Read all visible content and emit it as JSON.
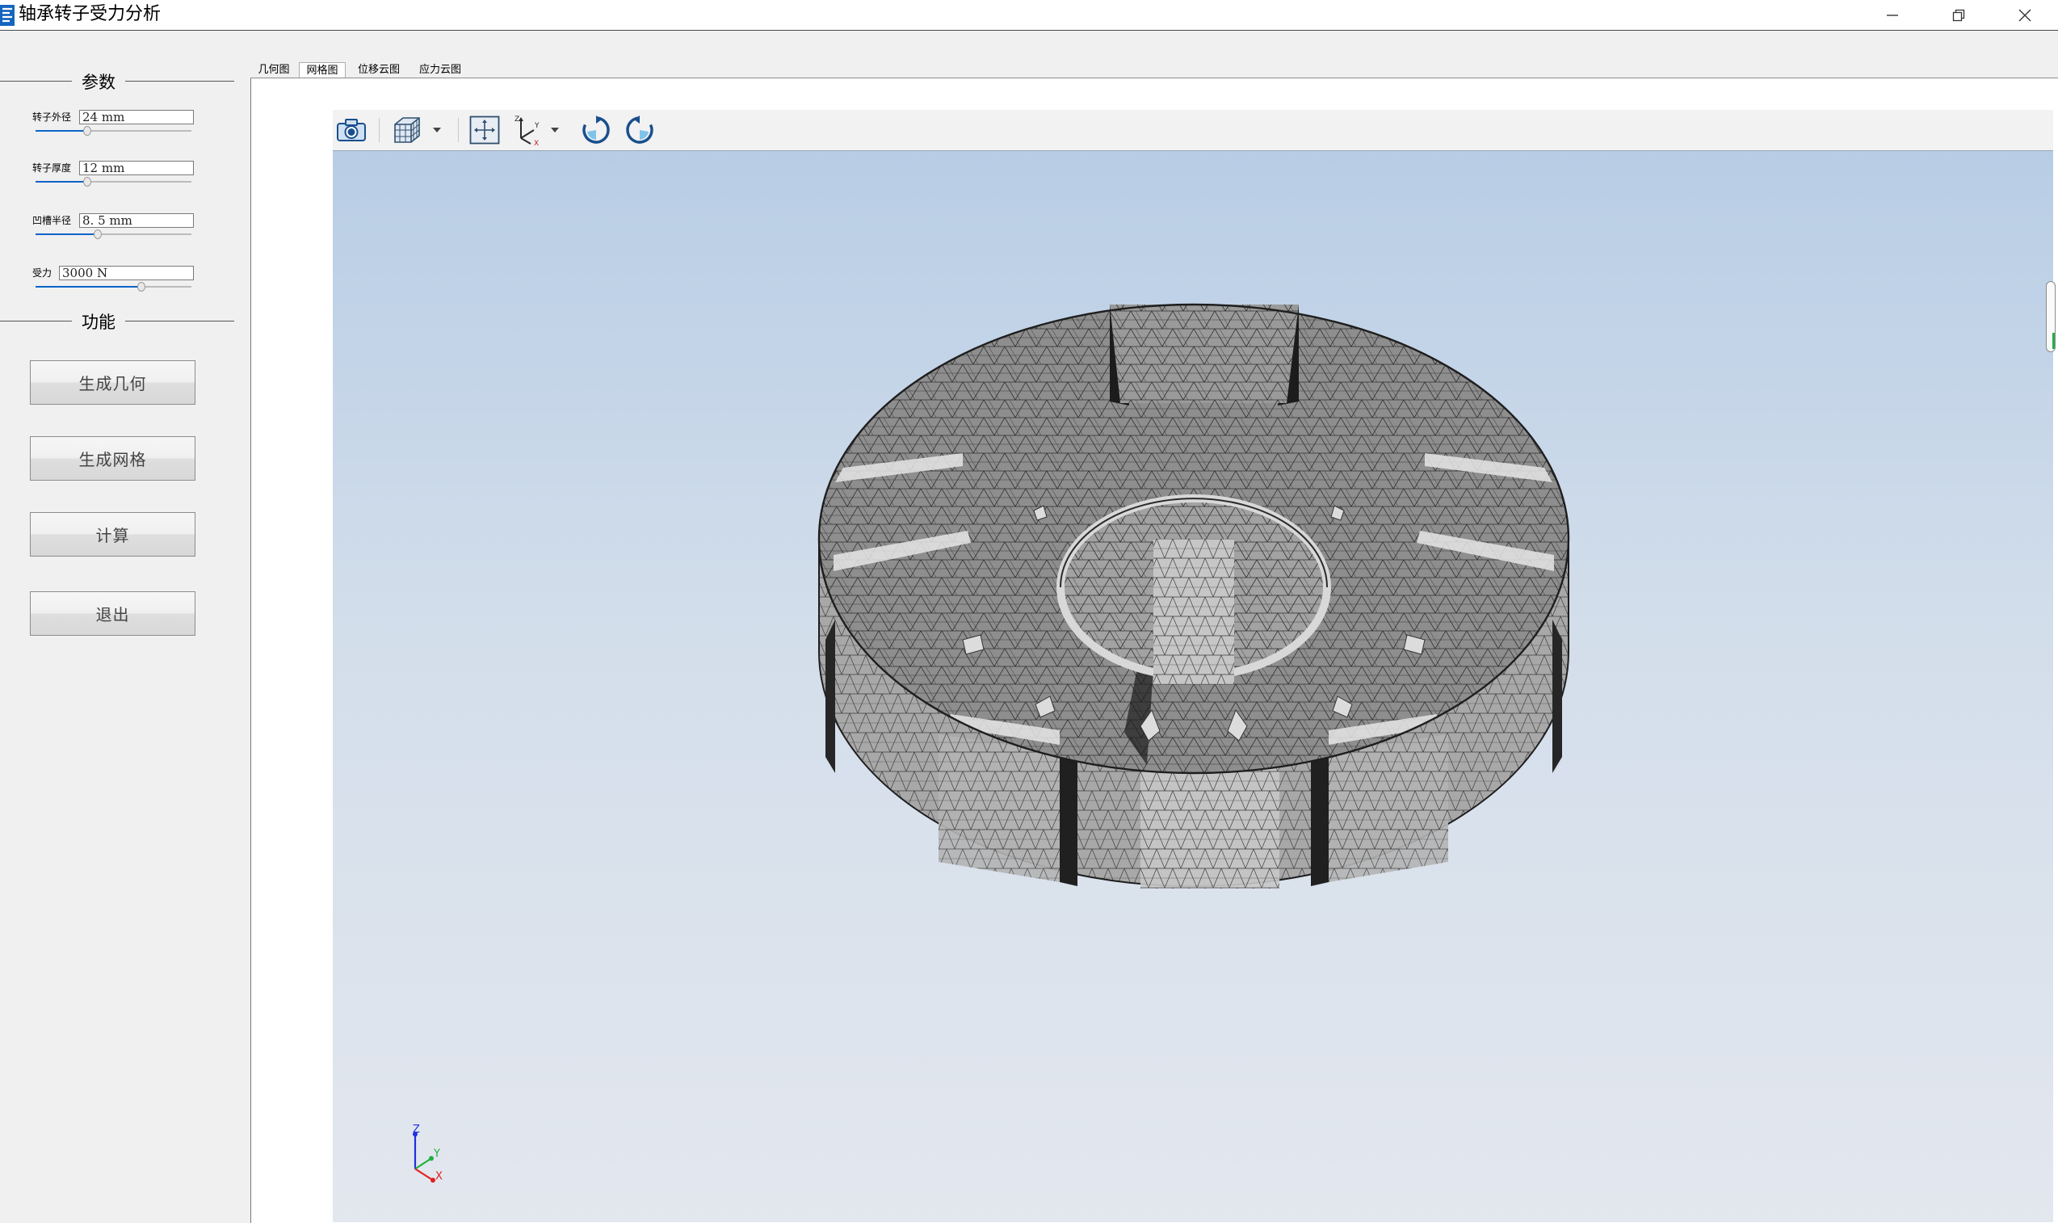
{
  "window": {
    "title": "轴承转子受力分析",
    "controls": [
      "minimize-icon",
      "restore-icon",
      "close-icon"
    ]
  },
  "params": {
    "group_title": "参数",
    "items": [
      {
        "label": "转子外径",
        "value": "24  mm",
        "slider_fraction": 0.33
      },
      {
        "label": "转子厚度",
        "value": "12  mm",
        "slider_fraction": 0.33
      },
      {
        "label": "凹槽半径",
        "value": "8. 5  mm",
        "slider_fraction": 0.4
      },
      {
        "label": "受力",
        "value": "3000  N",
        "slider_fraction": 0.68
      }
    ]
  },
  "functions": {
    "group_title": "功能",
    "buttons": [
      "生成几何",
      "生成网格",
      "计算",
      "退出"
    ]
  },
  "tabs": [
    {
      "label": "几何图",
      "active": false
    },
    {
      "label": "网格图",
      "active": true
    },
    {
      "label": "位移云图",
      "active": false
    },
    {
      "label": "应力云图",
      "active": false
    }
  ],
  "toolbar": {
    "icons": [
      "camera-icon",
      "view-cube-icon",
      "dropdown-arrow-icon",
      "fit-all-icon",
      "axes-orientation-icon",
      "dropdown-arrow-icon",
      "rotate-cw-icon",
      "rotate-ccw-icon"
    ]
  },
  "viewport": {
    "model": "meshed-rotor",
    "background_top": "#b8cde5",
    "background_bottom": "#e3e7ee",
    "mesh_color": "#8a8a8a",
    "axis_triad": {
      "x": "X",
      "y": "Y",
      "z": "Z"
    }
  },
  "colors": {
    "slider_fill": "#0a64c8",
    "axis_x": "#e02020",
    "axis_y": "#20b040",
    "axis_z": "#2030e0"
  }
}
